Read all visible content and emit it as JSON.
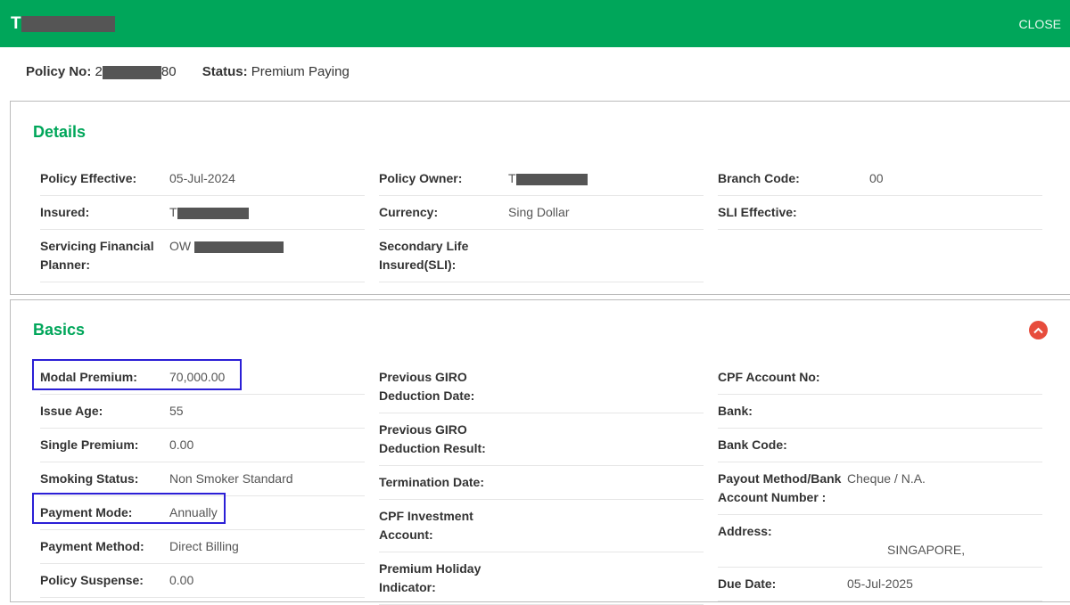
{
  "header": {
    "title_prefix": "T",
    "close_label": "CLOSE"
  },
  "policy": {
    "no_label": "Policy No:",
    "no_prefix": "2",
    "no_suffix": "80",
    "status_label": "Status:",
    "status": "Premium Paying"
  },
  "details": {
    "title": "Details",
    "col1": [
      {
        "label": "Policy Effective:",
        "value": "05-Jul-2024"
      },
      {
        "label": "Insured:",
        "value": "T"
      },
      {
        "label": "Servicing Financial Planner:",
        "value": "OW"
      }
    ],
    "col2": [
      {
        "label": "Policy Owner:",
        "value": "T"
      },
      {
        "label": "Currency:",
        "value": "Sing Dollar"
      },
      {
        "label": "Secondary Life Insured(SLI):",
        "value": ""
      }
    ],
    "col3": [
      {
        "label": "Branch Code:",
        "value": "00"
      },
      {
        "label": "SLI Effective:",
        "value": ""
      }
    ]
  },
  "basics": {
    "title": "Basics",
    "col1": [
      {
        "label": "Modal Premium:",
        "value": "70,000.00"
      },
      {
        "label": "Issue Age:",
        "value": "55"
      },
      {
        "label": "Single Premium:",
        "value": "0.00"
      },
      {
        "label": "Smoking Status:",
        "value": "Non Smoker Standard"
      },
      {
        "label": "Payment Mode:",
        "value": "Annually"
      },
      {
        "label": "Payment Method:",
        "value": "Direct Billing"
      },
      {
        "label": "Policy Suspense:",
        "value": "0.00"
      }
    ],
    "col2": [
      {
        "label": "Previous GIRO Deduction Date:",
        "value": ""
      },
      {
        "label": "Previous GIRO Deduction Result:",
        "value": ""
      },
      {
        "label": "Termination Date:",
        "value": ""
      },
      {
        "label": "CPF Investment Account:",
        "value": ""
      },
      {
        "label": "Premium Holiday Indicator:",
        "value": ""
      }
    ],
    "col3": [
      {
        "label": "CPF Account No:",
        "value": ""
      },
      {
        "label": "Bank:",
        "value": ""
      },
      {
        "label": "Bank Code:",
        "value": ""
      },
      {
        "label": "Payout Method/Bank Account Number :",
        "value": "Cheque / N.A."
      },
      {
        "label": "Address:",
        "value": "SINGAPORE,"
      },
      {
        "label": "Due Date:",
        "value": "05-Jul-2025"
      }
    ]
  },
  "colors": {
    "brand": "#00a65a",
    "highlight": "#2b1fd6",
    "collapse": "#e74c3c"
  }
}
